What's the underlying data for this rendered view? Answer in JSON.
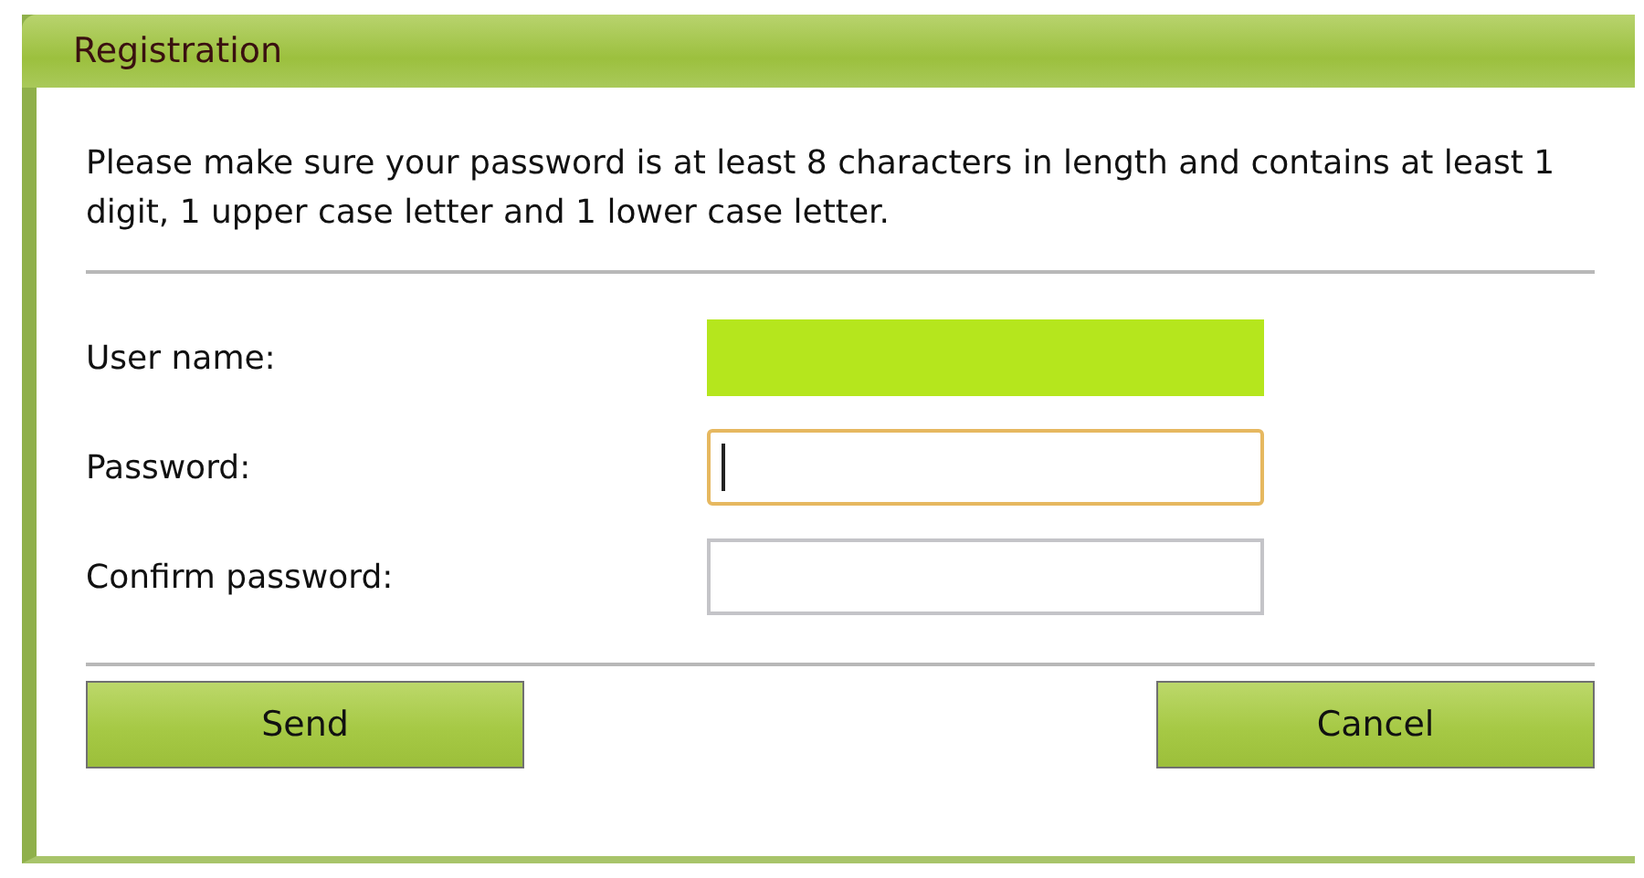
{
  "window": {
    "title": "Registration"
  },
  "instructions": "Please make sure your password is at least 8 characters in length and contains at least 1 digit, 1 upper case letter and 1 lower case letter.",
  "fields": [
    {
      "label": "User name:",
      "redacted": true,
      "focused": false
    },
    {
      "label": "Password:",
      "redacted": false,
      "focused": true
    },
    {
      "label": "Confirm password:",
      "redacted": false,
      "focused": false
    }
  ],
  "buttons": [
    "Send",
    "Cancel"
  ]
}
